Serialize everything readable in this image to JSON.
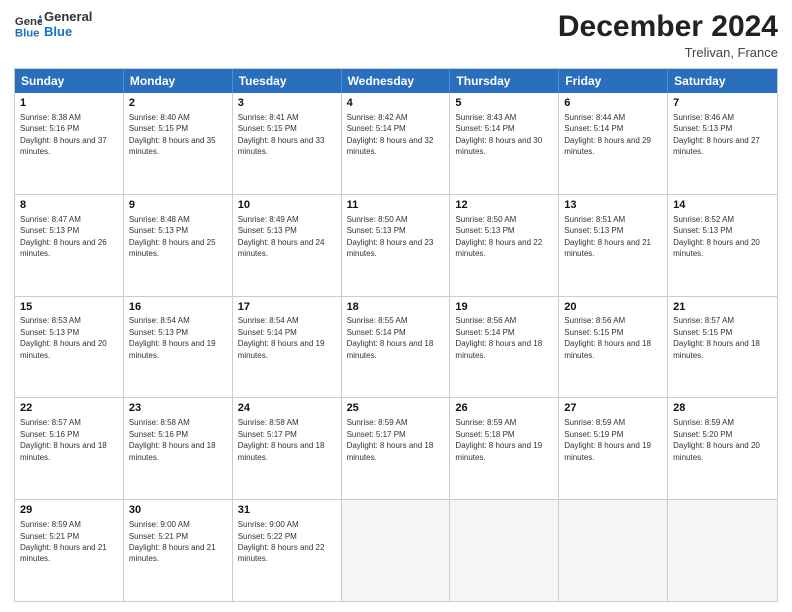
{
  "header": {
    "logo_line1": "General",
    "logo_line2": "Blue",
    "month": "December 2024",
    "location": "Trelivan, France"
  },
  "days_of_week": [
    "Sunday",
    "Monday",
    "Tuesday",
    "Wednesday",
    "Thursday",
    "Friday",
    "Saturday"
  ],
  "weeks": [
    [
      {
        "day": "1",
        "sunrise": "8:38 AM",
        "sunset": "5:16 PM",
        "daylight": "8 hours and 37 minutes."
      },
      {
        "day": "2",
        "sunrise": "8:40 AM",
        "sunset": "5:15 PM",
        "daylight": "8 hours and 35 minutes."
      },
      {
        "day": "3",
        "sunrise": "8:41 AM",
        "sunset": "5:15 PM",
        "daylight": "8 hours and 33 minutes."
      },
      {
        "day": "4",
        "sunrise": "8:42 AM",
        "sunset": "5:14 PM",
        "daylight": "8 hours and 32 minutes."
      },
      {
        "day": "5",
        "sunrise": "8:43 AM",
        "sunset": "5:14 PM",
        "daylight": "8 hours and 30 minutes."
      },
      {
        "day": "6",
        "sunrise": "8:44 AM",
        "sunset": "5:14 PM",
        "daylight": "8 hours and 29 minutes."
      },
      {
        "day": "7",
        "sunrise": "8:46 AM",
        "sunset": "5:13 PM",
        "daylight": "8 hours and 27 minutes."
      }
    ],
    [
      {
        "day": "8",
        "sunrise": "8:47 AM",
        "sunset": "5:13 PM",
        "daylight": "8 hours and 26 minutes."
      },
      {
        "day": "9",
        "sunrise": "8:48 AM",
        "sunset": "5:13 PM",
        "daylight": "8 hours and 25 minutes."
      },
      {
        "day": "10",
        "sunrise": "8:49 AM",
        "sunset": "5:13 PM",
        "daylight": "8 hours and 24 minutes."
      },
      {
        "day": "11",
        "sunrise": "8:50 AM",
        "sunset": "5:13 PM",
        "daylight": "8 hours and 23 minutes."
      },
      {
        "day": "12",
        "sunrise": "8:50 AM",
        "sunset": "5:13 PM",
        "daylight": "8 hours and 22 minutes."
      },
      {
        "day": "13",
        "sunrise": "8:51 AM",
        "sunset": "5:13 PM",
        "daylight": "8 hours and 21 minutes."
      },
      {
        "day": "14",
        "sunrise": "8:52 AM",
        "sunset": "5:13 PM",
        "daylight": "8 hours and 20 minutes."
      }
    ],
    [
      {
        "day": "15",
        "sunrise": "8:53 AM",
        "sunset": "5:13 PM",
        "daylight": "8 hours and 20 minutes."
      },
      {
        "day": "16",
        "sunrise": "8:54 AM",
        "sunset": "5:13 PM",
        "daylight": "8 hours and 19 minutes."
      },
      {
        "day": "17",
        "sunrise": "8:54 AM",
        "sunset": "5:14 PM",
        "daylight": "8 hours and 19 minutes."
      },
      {
        "day": "18",
        "sunrise": "8:55 AM",
        "sunset": "5:14 PM",
        "daylight": "8 hours and 18 minutes."
      },
      {
        "day": "19",
        "sunrise": "8:56 AM",
        "sunset": "5:14 PM",
        "daylight": "8 hours and 18 minutes."
      },
      {
        "day": "20",
        "sunrise": "8:56 AM",
        "sunset": "5:15 PM",
        "daylight": "8 hours and 18 minutes."
      },
      {
        "day": "21",
        "sunrise": "8:57 AM",
        "sunset": "5:15 PM",
        "daylight": "8 hours and 18 minutes."
      }
    ],
    [
      {
        "day": "22",
        "sunrise": "8:57 AM",
        "sunset": "5:16 PM",
        "daylight": "8 hours and 18 minutes."
      },
      {
        "day": "23",
        "sunrise": "8:58 AM",
        "sunset": "5:16 PM",
        "daylight": "8 hours and 18 minutes."
      },
      {
        "day": "24",
        "sunrise": "8:58 AM",
        "sunset": "5:17 PM",
        "daylight": "8 hours and 18 minutes."
      },
      {
        "day": "25",
        "sunrise": "8:59 AM",
        "sunset": "5:17 PM",
        "daylight": "8 hours and 18 minutes."
      },
      {
        "day": "26",
        "sunrise": "8:59 AM",
        "sunset": "5:18 PM",
        "daylight": "8 hours and 19 minutes."
      },
      {
        "day": "27",
        "sunrise": "8:59 AM",
        "sunset": "5:19 PM",
        "daylight": "8 hours and 19 minutes."
      },
      {
        "day": "28",
        "sunrise": "8:59 AM",
        "sunset": "5:20 PM",
        "daylight": "8 hours and 20 minutes."
      }
    ],
    [
      {
        "day": "29",
        "sunrise": "8:59 AM",
        "sunset": "5:21 PM",
        "daylight": "8 hours and 21 minutes."
      },
      {
        "day": "30",
        "sunrise": "9:00 AM",
        "sunset": "5:21 PM",
        "daylight": "8 hours and 21 minutes."
      },
      {
        "day": "31",
        "sunrise": "9:00 AM",
        "sunset": "5:22 PM",
        "daylight": "8 hours and 22 minutes."
      },
      null,
      null,
      null,
      null
    ]
  ]
}
